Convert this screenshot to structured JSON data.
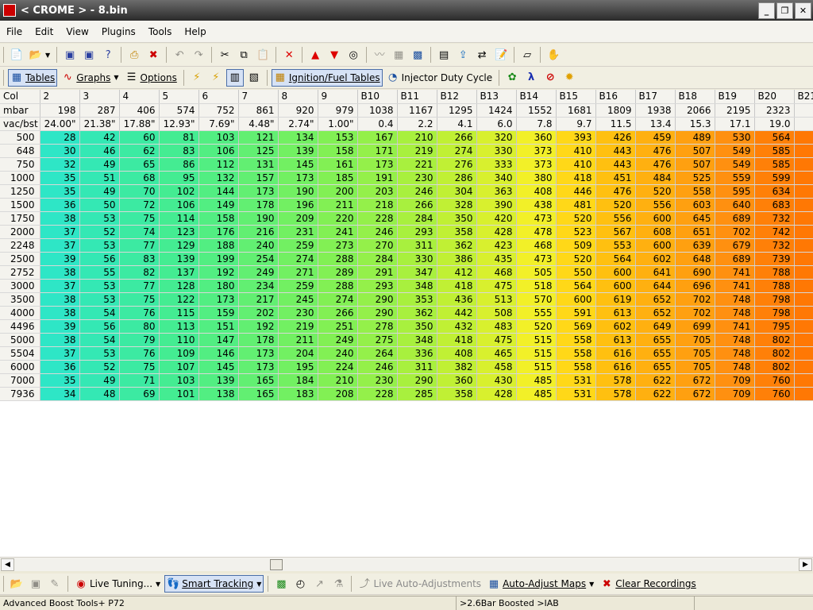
{
  "window": {
    "title": "< CROME > - 8.bin",
    "minimize": "_",
    "restore": "❐",
    "close": "✕"
  },
  "menu": [
    "File",
    "Edit",
    "View",
    "Plugins",
    "Tools",
    "Help"
  ],
  "toolbar2": {
    "tables": "Tables",
    "graphs": "Graphs",
    "options": "Options",
    "ign_fuel": "Ignition/Fuel Tables",
    "injector": "Injector Duty Cycle",
    "lambda": "λ"
  },
  "table": {
    "corner_col": "Col",
    "corner_mbar": "mbar",
    "corner_vac": "vac/bst",
    "columns": [
      "2",
      "3",
      "4",
      "5",
      "6",
      "7",
      "8",
      "9",
      "B10",
      "B11",
      "B12",
      "B13",
      "B14",
      "B15",
      "B16",
      "B17",
      "B18",
      "B19",
      "B20",
      "B21"
    ],
    "mbar": [
      "198",
      "287",
      "406",
      "574",
      "752",
      "861",
      "920",
      "979",
      "1038",
      "1167",
      "1295",
      "1424",
      "1552",
      "1681",
      "1809",
      "1938",
      "2066",
      "2195",
      "2323",
      "2"
    ],
    "vacbst": [
      "24.00\"",
      "21.38\"",
      "17.88\"",
      "12.93\"",
      "7.69\"",
      "4.48\"",
      "2.74\"",
      "1.00\"",
      "0.4",
      "2.2",
      "4.1",
      "6.0",
      "7.8",
      "9.7",
      "11.5",
      "13.4",
      "15.3",
      "17.1",
      "19.0",
      ""
    ],
    "rows": [
      {
        "rpm": "500",
        "v": [
          "28",
          "42",
          "60",
          "81",
          "103",
          "121",
          "134",
          "153",
          "167",
          "210",
          "266",
          "320",
          "360",
          "393",
          "426",
          "459",
          "489",
          "530",
          "564",
          ""
        ]
      },
      {
        "rpm": "648",
        "v": [
          "30",
          "46",
          "62",
          "83",
          "106",
          "125",
          "139",
          "158",
          "171",
          "219",
          "274",
          "330",
          "373",
          "410",
          "443",
          "476",
          "507",
          "549",
          "585",
          ""
        ]
      },
      {
        "rpm": "750",
        "v": [
          "32",
          "49",
          "65",
          "86",
          "112",
          "131",
          "145",
          "161",
          "173",
          "221",
          "276",
          "333",
          "373",
          "410",
          "443",
          "476",
          "507",
          "549",
          "585",
          ""
        ]
      },
      {
        "rpm": "1000",
        "v": [
          "35",
          "51",
          "68",
          "95",
          "132",
          "157",
          "173",
          "185",
          "191",
          "230",
          "286",
          "340",
          "380",
          "418",
          "451",
          "484",
          "525",
          "559",
          "599",
          ""
        ]
      },
      {
        "rpm": "1250",
        "v": [
          "35",
          "49",
          "70",
          "102",
          "144",
          "173",
          "190",
          "200",
          "203",
          "246",
          "304",
          "363",
          "408",
          "446",
          "476",
          "520",
          "558",
          "595",
          "634",
          ""
        ]
      },
      {
        "rpm": "1500",
        "v": [
          "36",
          "50",
          "72",
          "106",
          "149",
          "178",
          "196",
          "211",
          "218",
          "266",
          "328",
          "390",
          "438",
          "481",
          "520",
          "556",
          "603",
          "640",
          "683",
          ""
        ]
      },
      {
        "rpm": "1750",
        "v": [
          "38",
          "53",
          "75",
          "114",
          "158",
          "190",
          "209",
          "220",
          "228",
          "284",
          "350",
          "420",
          "473",
          "520",
          "556",
          "600",
          "645",
          "689",
          "732",
          ""
        ]
      },
      {
        "rpm": "2000",
        "v": [
          "37",
          "52",
          "74",
          "123",
          "176",
          "216",
          "231",
          "241",
          "246",
          "293",
          "358",
          "428",
          "478",
          "523",
          "567",
          "608",
          "651",
          "702",
          "742",
          ""
        ]
      },
      {
        "rpm": "2248",
        "v": [
          "37",
          "53",
          "77",
          "129",
          "188",
          "240",
          "259",
          "273",
          "270",
          "311",
          "362",
          "423",
          "468",
          "509",
          "553",
          "600",
          "639",
          "679",
          "732",
          ""
        ]
      },
      {
        "rpm": "2500",
        "v": [
          "39",
          "56",
          "83",
          "139",
          "199",
          "254",
          "274",
          "288",
          "284",
          "330",
          "386",
          "435",
          "473",
          "520",
          "564",
          "602",
          "648",
          "689",
          "739",
          ""
        ]
      },
      {
        "rpm": "2752",
        "v": [
          "38",
          "55",
          "82",
          "137",
          "192",
          "249",
          "271",
          "289",
          "291",
          "347",
          "412",
          "468",
          "505",
          "550",
          "600",
          "641",
          "690",
          "741",
          "788",
          ""
        ]
      },
      {
        "rpm": "3000",
        "v": [
          "37",
          "53",
          "77",
          "128",
          "180",
          "234",
          "259",
          "288",
          "293",
          "348",
          "418",
          "475",
          "518",
          "564",
          "600",
          "644",
          "696",
          "741",
          "788",
          ""
        ]
      },
      {
        "rpm": "3500",
        "v": [
          "38",
          "53",
          "75",
          "122",
          "173",
          "217",
          "245",
          "274",
          "290",
          "353",
          "436",
          "513",
          "570",
          "600",
          "619",
          "652",
          "702",
          "748",
          "798",
          ""
        ]
      },
      {
        "rpm": "4000",
        "v": [
          "38",
          "54",
          "76",
          "115",
          "159",
          "202",
          "230",
          "266",
          "290",
          "362",
          "442",
          "508",
          "555",
          "591",
          "613",
          "652",
          "702",
          "748",
          "798",
          ""
        ]
      },
      {
        "rpm": "4496",
        "v": [
          "39",
          "56",
          "80",
          "113",
          "151",
          "192",
          "219",
          "251",
          "278",
          "350",
          "432",
          "483",
          "520",
          "569",
          "602",
          "649",
          "699",
          "741",
          "795",
          ""
        ]
      },
      {
        "rpm": "5000",
        "v": [
          "38",
          "54",
          "79",
          "110",
          "147",
          "178",
          "211",
          "249",
          "275",
          "348",
          "418",
          "475",
          "515",
          "558",
          "613",
          "655",
          "705",
          "748",
          "802",
          ""
        ]
      },
      {
        "rpm": "5504",
        "v": [
          "37",
          "53",
          "76",
          "109",
          "146",
          "173",
          "204",
          "240",
          "264",
          "336",
          "408",
          "465",
          "515",
          "558",
          "616",
          "655",
          "705",
          "748",
          "802",
          ""
        ]
      },
      {
        "rpm": "6000",
        "v": [
          "36",
          "52",
          "75",
          "107",
          "145",
          "173",
          "195",
          "224",
          "246",
          "311",
          "382",
          "458",
          "515",
          "558",
          "616",
          "655",
          "705",
          "748",
          "802",
          ""
        ]
      },
      {
        "rpm": "7000",
        "v": [
          "35",
          "49",
          "71",
          "103",
          "139",
          "165",
          "184",
          "210",
          "230",
          "290",
          "360",
          "430",
          "485",
          "531",
          "578",
          "622",
          "672",
          "709",
          "760",
          ""
        ]
      },
      {
        "rpm": "7936",
        "v": [
          "34",
          "48",
          "69",
          "101",
          "138",
          "165",
          "183",
          "208",
          "228",
          "285",
          "358",
          "428",
          "485",
          "531",
          "578",
          "622",
          "672",
          "709",
          "760",
          ""
        ]
      }
    ]
  },
  "colors": {
    "col_gradient": [
      "#2ee6c6",
      "#34e8b4",
      "#3ceaa2",
      "#44ec92",
      "#52ee82",
      "#62ef72",
      "#72f062",
      "#82f054",
      "#94f04a",
      "#a8f03e",
      "#c0f034",
      "#d8f02e",
      "#f2f028",
      "#ffd818",
      "#ffc010",
      "#ffb010",
      "#ffa010",
      "#ff9010",
      "#ff8008",
      "#ff7804"
    ]
  },
  "bottombar": {
    "live_tuning": "Live Tuning...",
    "smart_tracking": "Smart Tracking",
    "live_auto": "Live Auto-Adjustments",
    "auto_adjust": "Auto-Adjust Maps",
    "clear_recordings": "Clear Recordings"
  },
  "status": {
    "left": "Advanced Boost Tools+ P72",
    "middle": ">2.6Bar Boosted >IAB"
  }
}
